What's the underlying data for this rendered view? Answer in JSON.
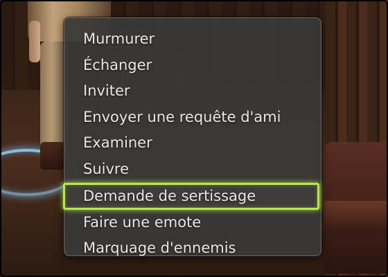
{
  "context_menu": {
    "items": [
      {
        "label": "Murmurer",
        "selected": false
      },
      {
        "label": "Échanger",
        "selected": false
      },
      {
        "label": "Inviter",
        "selected": false
      },
      {
        "label": "Envoyer une requête d'ami",
        "selected": false
      },
      {
        "label": "Examiner",
        "selected": false
      },
      {
        "label": "Suivre",
        "selected": false
      },
      {
        "label": "Demande de sertissage",
        "selected": true
      },
      {
        "label": "Faire une emote",
        "selected": false
      },
      {
        "label": "Marquage d'ennemis",
        "selected": false
      }
    ],
    "highlight_color": "#b7ea4a"
  }
}
